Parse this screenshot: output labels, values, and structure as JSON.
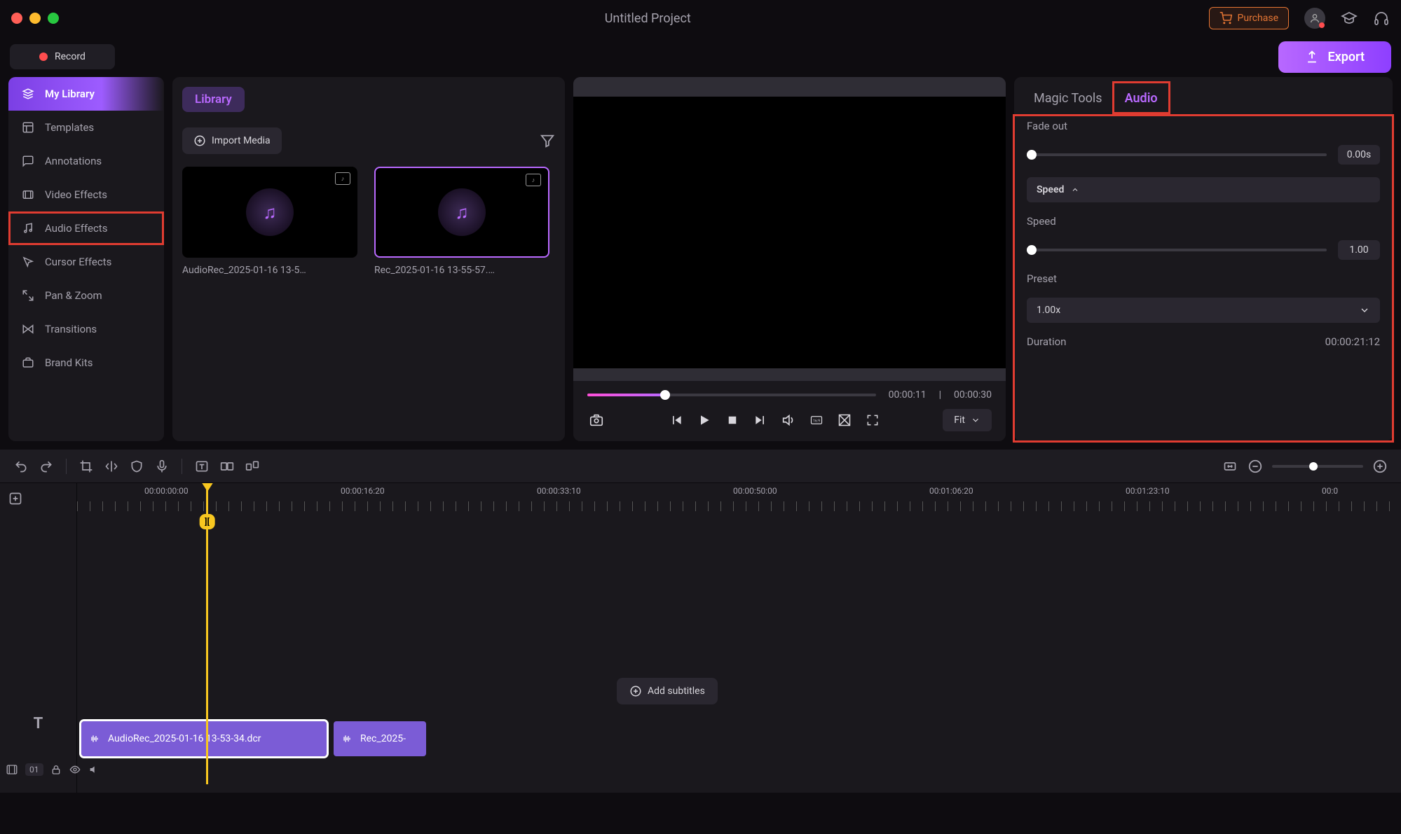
{
  "titlebar": {
    "title": "Untitled Project",
    "purchase": "Purchase"
  },
  "actions": {
    "record": "Record",
    "export": "Export"
  },
  "sidebar": {
    "items": [
      {
        "label": "My Library"
      },
      {
        "label": "Templates"
      },
      {
        "label": "Annotations"
      },
      {
        "label": "Video Effects"
      },
      {
        "label": "Audio Effects"
      },
      {
        "label": "Cursor Effects"
      },
      {
        "label": "Pan & Zoom"
      },
      {
        "label": "Transitions"
      },
      {
        "label": "Brand Kits"
      }
    ]
  },
  "library": {
    "tab": "Library",
    "import": "Import Media",
    "items": [
      {
        "name": "AudioRec_2025-01-16 13-5…"
      },
      {
        "name": "Rec_2025-01-16 13-55-57.…"
      }
    ]
  },
  "player": {
    "current": "00:00:11",
    "total": "00:00:30",
    "fit": "Fit"
  },
  "props": {
    "tabs": {
      "magic": "Magic Tools",
      "audio": "Audio"
    },
    "fadeout_label": "Fade out",
    "fadeout_value": "0.00s",
    "speed_section": "Speed",
    "speed_label": "Speed",
    "speed_value": "1.00",
    "preset_label": "Preset",
    "preset_value": "1.00x",
    "duration_label": "Duration",
    "duration_value": "00:00:21:12"
  },
  "timeline": {
    "ruler": [
      "00:00:00:00",
      "00:00:16:20",
      "00:00:33:10",
      "00:00:50:00",
      "00:01:06:20",
      "00:01:23:10",
      "00:0"
    ],
    "playhead_handle": "][",
    "subtitle": "Add subtitles",
    "track_number": "01",
    "clips": [
      {
        "name": "AudioRec_2025-01-16 13-53-34.dcr"
      },
      {
        "name": "Rec_2025-"
      }
    ]
  }
}
